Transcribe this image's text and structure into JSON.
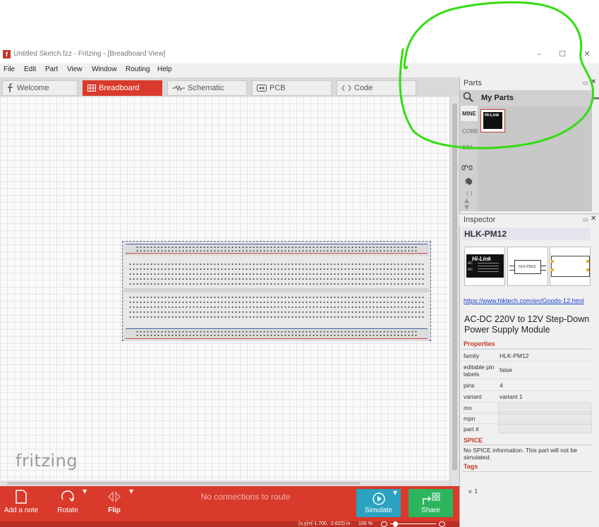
{
  "window": {
    "app_icon": "f",
    "title": "Untitled Sketch.fzz - Fritzing - [Breadboard View]",
    "minimize": "–",
    "maximize": "☐",
    "close": "✕"
  },
  "menu": [
    "File",
    "Edit",
    "Part",
    "View",
    "Window",
    "Routing",
    "Help"
  ],
  "tabs": [
    {
      "label": "Welcome",
      "icon": "fritzing-f-icon"
    },
    {
      "label": "Breadboard",
      "icon": "breadboard-icon",
      "active": true
    },
    {
      "label": "Schematic",
      "icon": "resistor-icon"
    },
    {
      "label": "PCB",
      "icon": "pcb-icon"
    },
    {
      "label": "Code",
      "icon": "code-brackets-icon"
    }
  ],
  "canvas": {
    "logo": "fritzing"
  },
  "toolbar": {
    "add_note": "Add a note",
    "rotate": "Rotate",
    "flip": "Flip",
    "status": "No connections to route",
    "simulate": "Simulate",
    "share": "Share"
  },
  "statusbar": {
    "coords": "(x,y)=(-1.700, -2.622) in",
    "zoom": "100 %"
  },
  "parts": {
    "title": "Parts",
    "bin_title": "My Parts",
    "side_tabs": [
      "MINE",
      "CORE",
      "SIM"
    ],
    "part_thumb_label": "Hi-Link"
  },
  "inspector": {
    "title": "Inspector",
    "part_title": "HLK-PM12",
    "link": "https://www.hlktech.com/en/Goods-12.html",
    "description": "AC-DC 220V to 12V Step-Down Power Supply Module",
    "image_labels": {
      "breadboard_brand": "Hi-Link",
      "breadboard_pin_ac1": "AC",
      "breadboard_pin_ac2": "AC",
      "schematic_label": "HLK-PM12"
    },
    "properties_label": "Properties",
    "properties": [
      {
        "name": "family",
        "value": "HLK-PM12"
      },
      {
        "name": "editable pin labels",
        "value": "false"
      },
      {
        "name": "pins",
        "value": "4"
      },
      {
        "name": "variant",
        "value": "variant 1"
      },
      {
        "name": "mn",
        "value": ""
      },
      {
        "name": "mpn",
        "value": ""
      },
      {
        "name": "part #",
        "value": ""
      }
    ],
    "spice_label": "SPICE",
    "spice_text": "No SPICE information. This part will not be simulated.",
    "tags_label": "Tags",
    "version": "v. 1"
  },
  "colors": {
    "accent_red": "#d93a2b",
    "simulate_blue": "#2aa2c0",
    "share_green": "#2db55d",
    "annotation_green": "#33dd11"
  }
}
